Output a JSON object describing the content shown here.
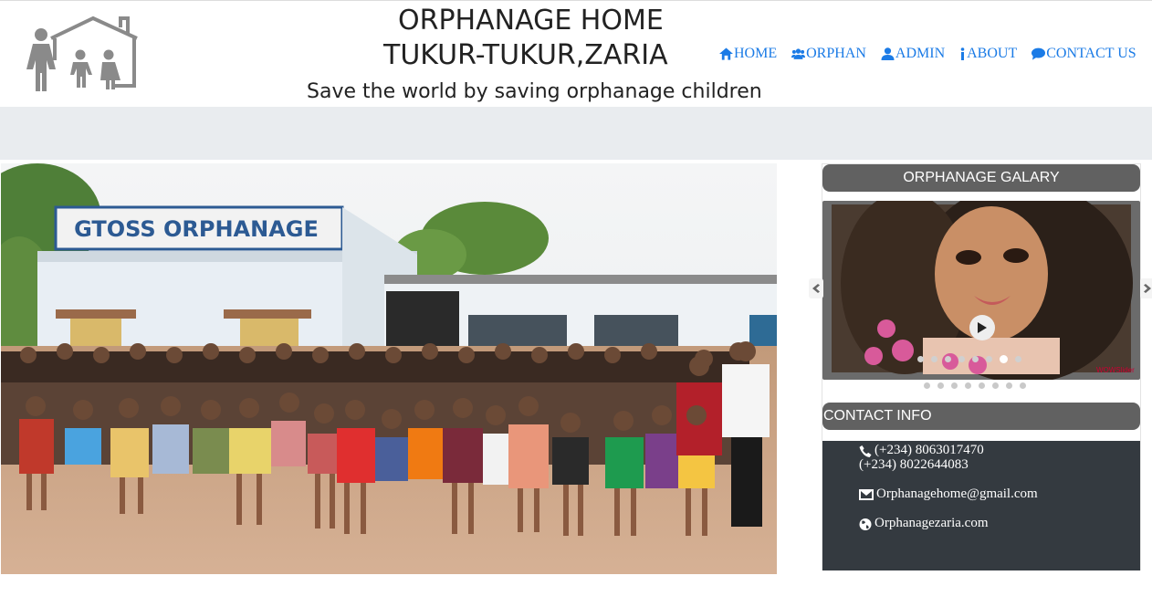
{
  "header": {
    "title_line1": "ORPHANAGE HOME",
    "title_line2": "TUKUR-TUKUR,ZARIA",
    "tagline": "Save the world by saving orphanage children"
  },
  "nav": {
    "items": [
      {
        "label": "HOME",
        "icon": "home-icon"
      },
      {
        "label": "ORPHAN",
        "icon": "users-icon"
      },
      {
        "label": "ADMIN",
        "icon": "user-icon"
      },
      {
        "label": "ABOUT",
        "icon": "info-icon"
      },
      {
        "label": "CONTACT US",
        "icon": "comment-icon"
      }
    ]
  },
  "hero": {
    "sign_text": "GTOSS ORPHANAGE"
  },
  "gallery": {
    "title": "ORPHANAGE GALARY",
    "watermark": "WOWSlider",
    "slide_count": 8,
    "active_slide": 6
  },
  "contact": {
    "title": "CONTACT INFO",
    "phone1": "(+234) 8063017470",
    "phone2": "(+234) 8022644083",
    "email": "Orphanagehome@gmail.com",
    "website": "Orphanagezaria.com"
  },
  "colors": {
    "nav_link": "#1b7be6",
    "panel_head": "#616161",
    "contact_bg": "#343a40",
    "band": "#e9ecef"
  }
}
